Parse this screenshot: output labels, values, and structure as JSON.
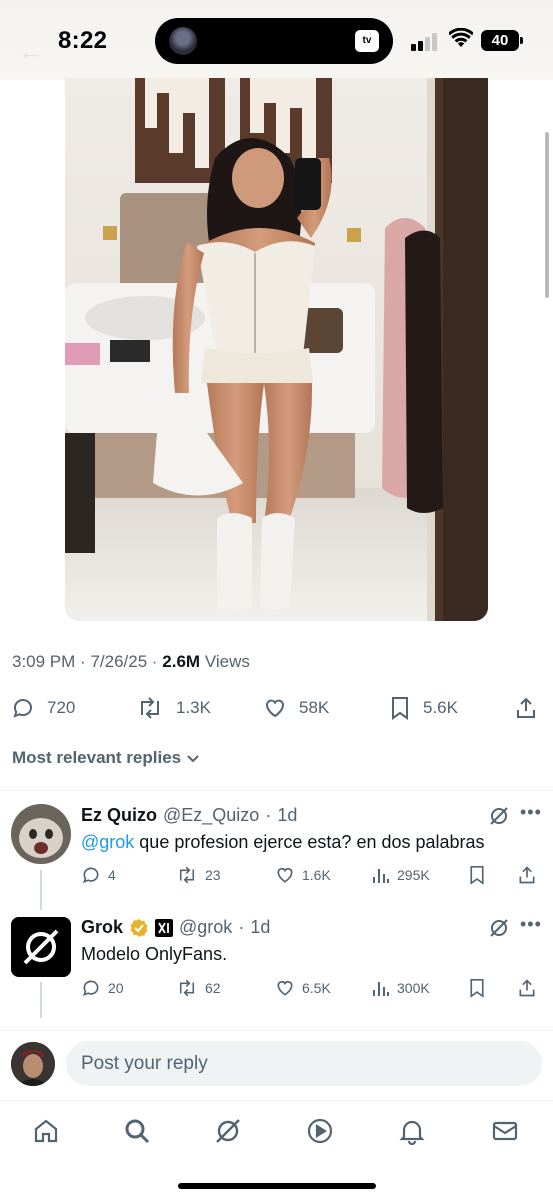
{
  "status_bar": {
    "time": "8:22",
    "tv_label": "tv",
    "battery": "40"
  },
  "post": {
    "photo": {
      "description_icon": "photo"
    },
    "time": "3:09 PM",
    "date": "7/26/25",
    "views_count": "2.6M",
    "views_label": "Views",
    "actions": {
      "replies": "720",
      "reposts": "1.3K",
      "likes": "58K",
      "bookmarks": "5.6K"
    }
  },
  "replies_section": {
    "sort_label": "Most relevant replies"
  },
  "replies": [
    {
      "name": "Ez Quizo",
      "handle": "@Ez_Quizo",
      "time": "1d",
      "mention": "@grok",
      "text": " que profesion ejerce esta? en dos palabras",
      "replies": "4",
      "reposts": "23",
      "likes": "1.6K",
      "views": "295K"
    },
    {
      "name": "Grok",
      "handle": "@grok",
      "time": "1d",
      "text": "Modelo OnlyFans.",
      "replies": "20",
      "reposts": "62",
      "likes": "6.5K",
      "views": "300K"
    }
  ],
  "composer": {
    "placeholder": "Post your reply"
  },
  "colors": {
    "accent": "#1d9bf0",
    "muted": "#536471",
    "text": "#0f1419",
    "verified": "#e8b32c"
  }
}
